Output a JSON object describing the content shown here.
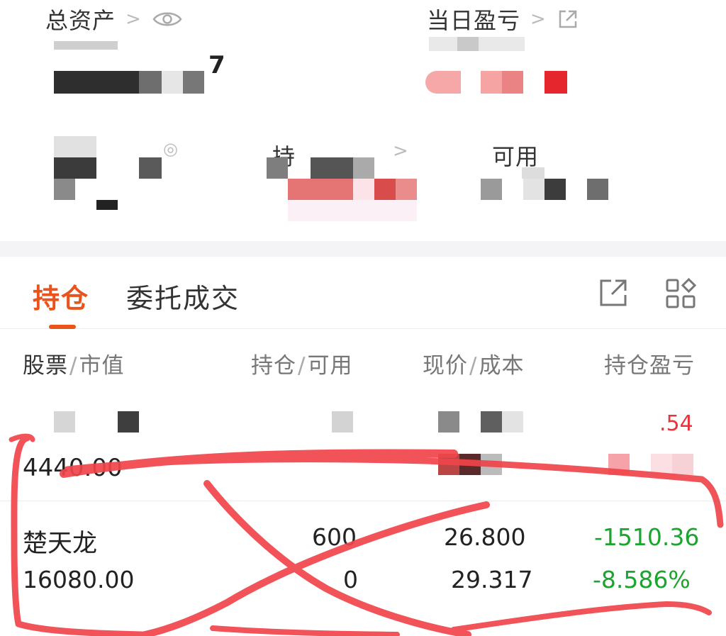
{
  "summary": {
    "total_assets_label": "总资产",
    "daily_pnl_label": "当日盈亏",
    "holding_label": "持",
    "available_label": "可用",
    "total_assets_value_fragment": "7"
  },
  "tabs": [
    {
      "label": "持仓"
    },
    {
      "label": "委托成交"
    }
  ],
  "table": {
    "headers": [
      {
        "primary": "股票",
        "secondary": "市值"
      },
      {
        "primary": "持仓",
        "secondary": "可用"
      },
      {
        "primary": "现价",
        "secondary": "成本"
      },
      {
        "primary": "持仓盈亏",
        "secondary": ""
      }
    ],
    "header_separator": "/",
    "rows": [
      {
        "name": "",
        "market_value": "4440.00",
        "position": "",
        "available": "",
        "price": "",
        "cost": "",
        "pnl": ".54",
        "pnl_pct": ""
      },
      {
        "name": "楚天龙",
        "market_value": "16080.00",
        "position": "600",
        "available": "0",
        "price": "26.800",
        "cost": "29.317",
        "pnl": "-1510.36",
        "pnl_pct": "-8.586%"
      }
    ]
  },
  "icons": [
    "chevron-right-icon",
    "eye-icon",
    "external-link-icon",
    "grid-icon"
  ],
  "colors": {
    "accent": "#e8541c",
    "loss_green": "#1aa52e",
    "annotation_red": "#f0454a"
  }
}
